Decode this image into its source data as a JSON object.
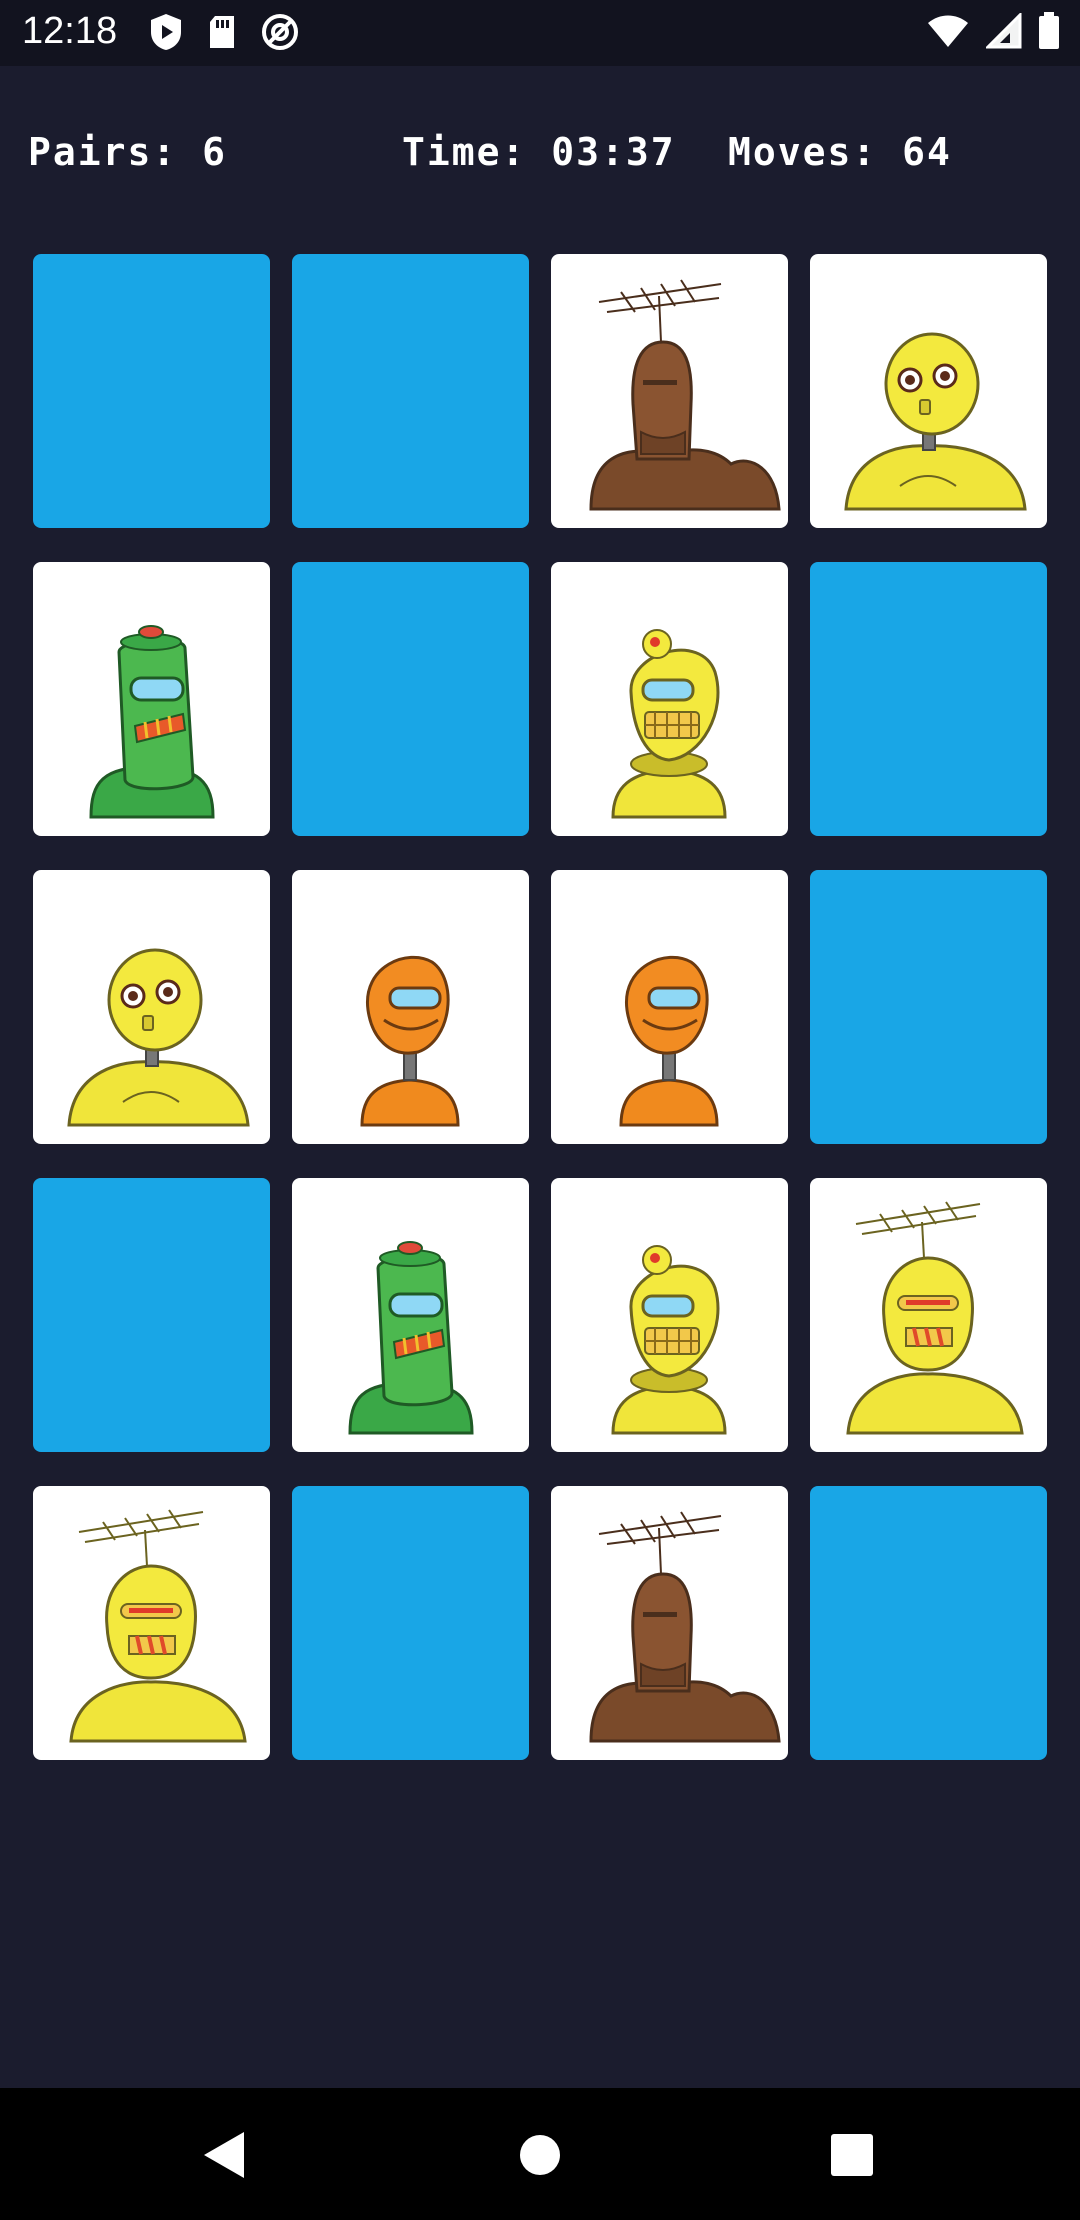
{
  "status_bar": {
    "time": "12:18",
    "icons_left": [
      "play-protect-icon",
      "sd-card-icon",
      "at-sign-icon"
    ],
    "icons_right": [
      "wifi-icon",
      "cellular-signal-icon",
      "battery-icon"
    ]
  },
  "hud": {
    "pairs": "Pairs: 6",
    "time": "Time: 03:37",
    "moves": "Moves: 64"
  },
  "colors": {
    "background": "#1b1c2e",
    "card_back": "#19a6e6",
    "card_face": "#ffffff"
  },
  "board": {
    "columns": 4,
    "rows": 5,
    "cards": [
      {
        "state": "hidden"
      },
      {
        "state": "hidden"
      },
      {
        "state": "revealed",
        "robot": "brown-antenna-robot"
      },
      {
        "state": "revealed",
        "robot": "yellow-round-robot"
      },
      {
        "state": "revealed",
        "robot": "green-cylinder-robot"
      },
      {
        "state": "hidden"
      },
      {
        "state": "revealed",
        "robot": "yellow-visor-robot"
      },
      {
        "state": "hidden"
      },
      {
        "state": "revealed",
        "robot": "yellow-round-robot"
      },
      {
        "state": "revealed",
        "robot": "orange-visor-robot"
      },
      {
        "state": "revealed",
        "robot": "orange-visor-robot"
      },
      {
        "state": "hidden"
      },
      {
        "state": "hidden"
      },
      {
        "state": "revealed",
        "robot": "green-cylinder-robot"
      },
      {
        "state": "revealed",
        "robot": "yellow-visor-robot"
      },
      {
        "state": "revealed",
        "robot": "yellow-antenna-robot"
      },
      {
        "state": "revealed",
        "robot": "yellow-antenna-robot"
      },
      {
        "state": "hidden"
      },
      {
        "state": "revealed",
        "robot": "brown-antenna-robot"
      },
      {
        "state": "hidden"
      }
    ]
  },
  "nav_bar": {
    "buttons": [
      "back-icon",
      "home-icon",
      "recents-icon"
    ]
  }
}
